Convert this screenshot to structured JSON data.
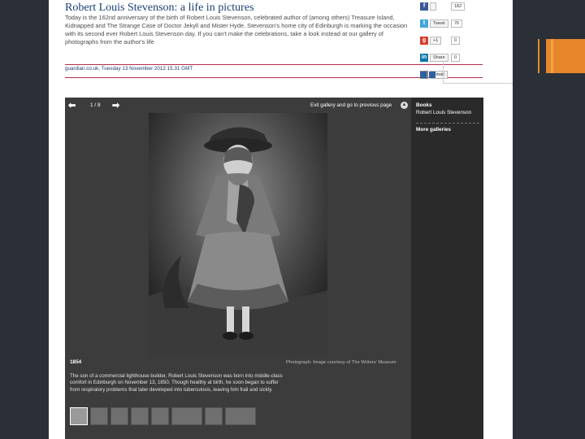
{
  "article": {
    "headline": "Robert Louis Stevenson: a life in pictures",
    "standfirst": "Today is the 162nd anniversary of the birth of Robert Louis Stevenson, celebrated author of (among others) Treasure Island, Kidnapped and The Strange Case of Doctor Jekyll and Mister Hyde. Stevenson's home city of Edinburgh is marking the occasion with its second ever Robert Louis Stevenson day. If you can't make the celebrations, take a look instead at our gallery of photographs from the author's life",
    "dateline": "guardian.co.uk, Tuesday 13 November 2012 15.31 GMT"
  },
  "share": {
    "facebook": {
      "icon": "facebook-icon",
      "label": "",
      "count": "182"
    },
    "twitter": {
      "icon": "twitter-icon",
      "label": "Tweet",
      "count": "76"
    },
    "googleplus": {
      "icon": "google-plus-icon",
      "label": "+1",
      "count": "0"
    },
    "linkedin": {
      "icon": "linkedin-icon",
      "label": "Share",
      "count": "0"
    },
    "email": {
      "icon": "email-icon",
      "label": "Email",
      "count": ""
    }
  },
  "gallery": {
    "counter": "1 / 8",
    "exit_label": "Exit gallery and go to previous page",
    "year": "1854",
    "caption": "The son of a commercial lighthouse builder, Robert Louis Stevenson was born into middle-class comfort in Edinburgh on November 13, 1850. Though healthy at birth, he soon began to suffer from respiratory problems that later developed into tuberculosis, leaving him frail and sickly.",
    "credit": "Photograph: Image courtesy of The Writers' Museum",
    "photo_alt": "Child in bonnet and cape, sepia photograph",
    "thumb_count": 8
  },
  "sidebar": {
    "section": "Books",
    "topic": "Robert Louis Stevenson",
    "more": "More galleries"
  },
  "colors": {
    "slide_bg": "#2b3038",
    "accent": "#e8862a",
    "headline": "#1a3f73",
    "rule": "#b22a4a",
    "gallery_bg": "#3c3c3c"
  }
}
